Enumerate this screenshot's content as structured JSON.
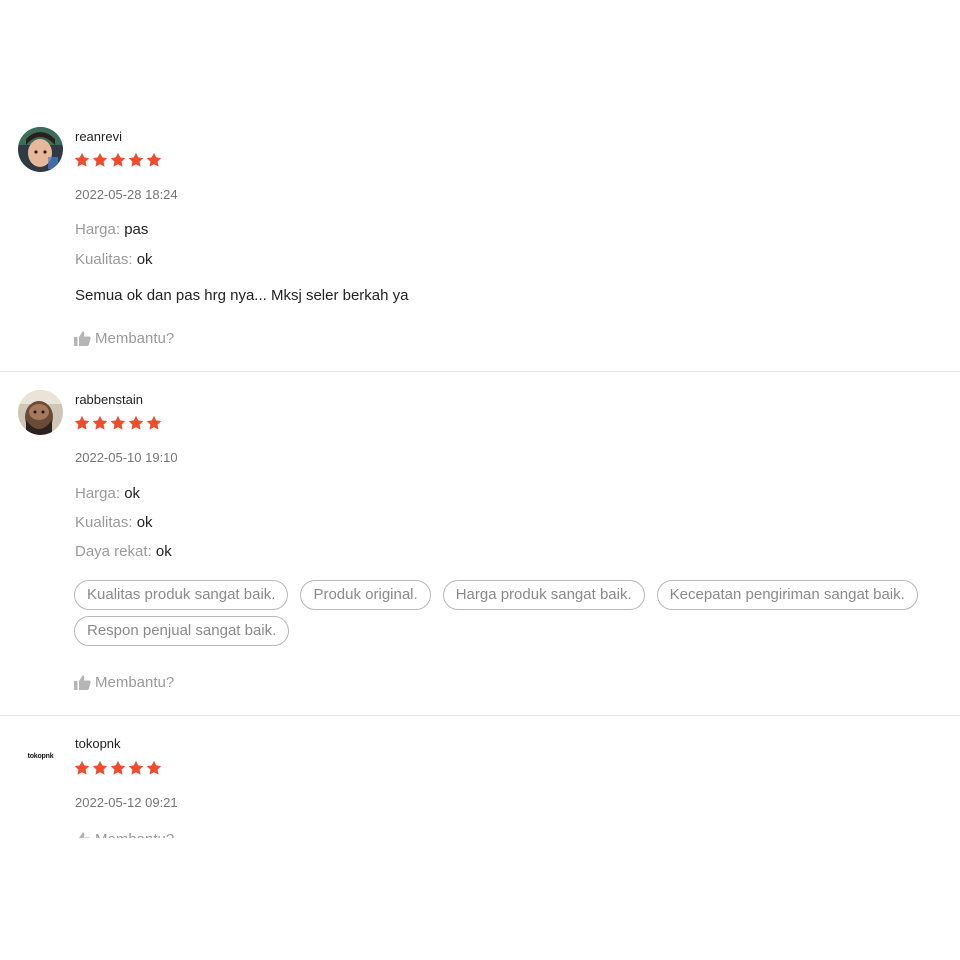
{
  "colors": {
    "star": "#ee4d2d",
    "muted": "#9a9a9a",
    "divider": "#e6e6e6"
  },
  "helpful_label": "Membantu?",
  "reviews": [
    {
      "username": "reanrevi",
      "rating": 5,
      "timestamp": "2022-05-28 18:24",
      "attributes": [
        {
          "key": "Harga:",
          "value": "pas"
        },
        {
          "key": "Kualitas:",
          "value": "ok"
        }
      ],
      "comment": "Semua ok dan pas hrg nya... Mksj seler berkah ya",
      "tags": []
    },
    {
      "username": "rabbenstain",
      "rating": 5,
      "timestamp": "2022-05-10 19:10",
      "attributes": [
        {
          "key": "Harga:",
          "value": "ok"
        },
        {
          "key": "Kualitas:",
          "value": "ok"
        },
        {
          "key": "Daya rekat:",
          "value": "ok"
        }
      ],
      "comment": "",
      "tags": [
        "Kualitas produk sangat baik.",
        "Produk original.",
        "Harga produk sangat baik.",
        "Kecepatan pengiriman sangat baik.",
        "Respon penjual sangat baik."
      ]
    },
    {
      "username": "tokopnk",
      "rating": 5,
      "timestamp": "2022-05-12 09:21",
      "avatar_text": "tokopnk",
      "attributes": [],
      "comment": "",
      "tags": []
    }
  ]
}
